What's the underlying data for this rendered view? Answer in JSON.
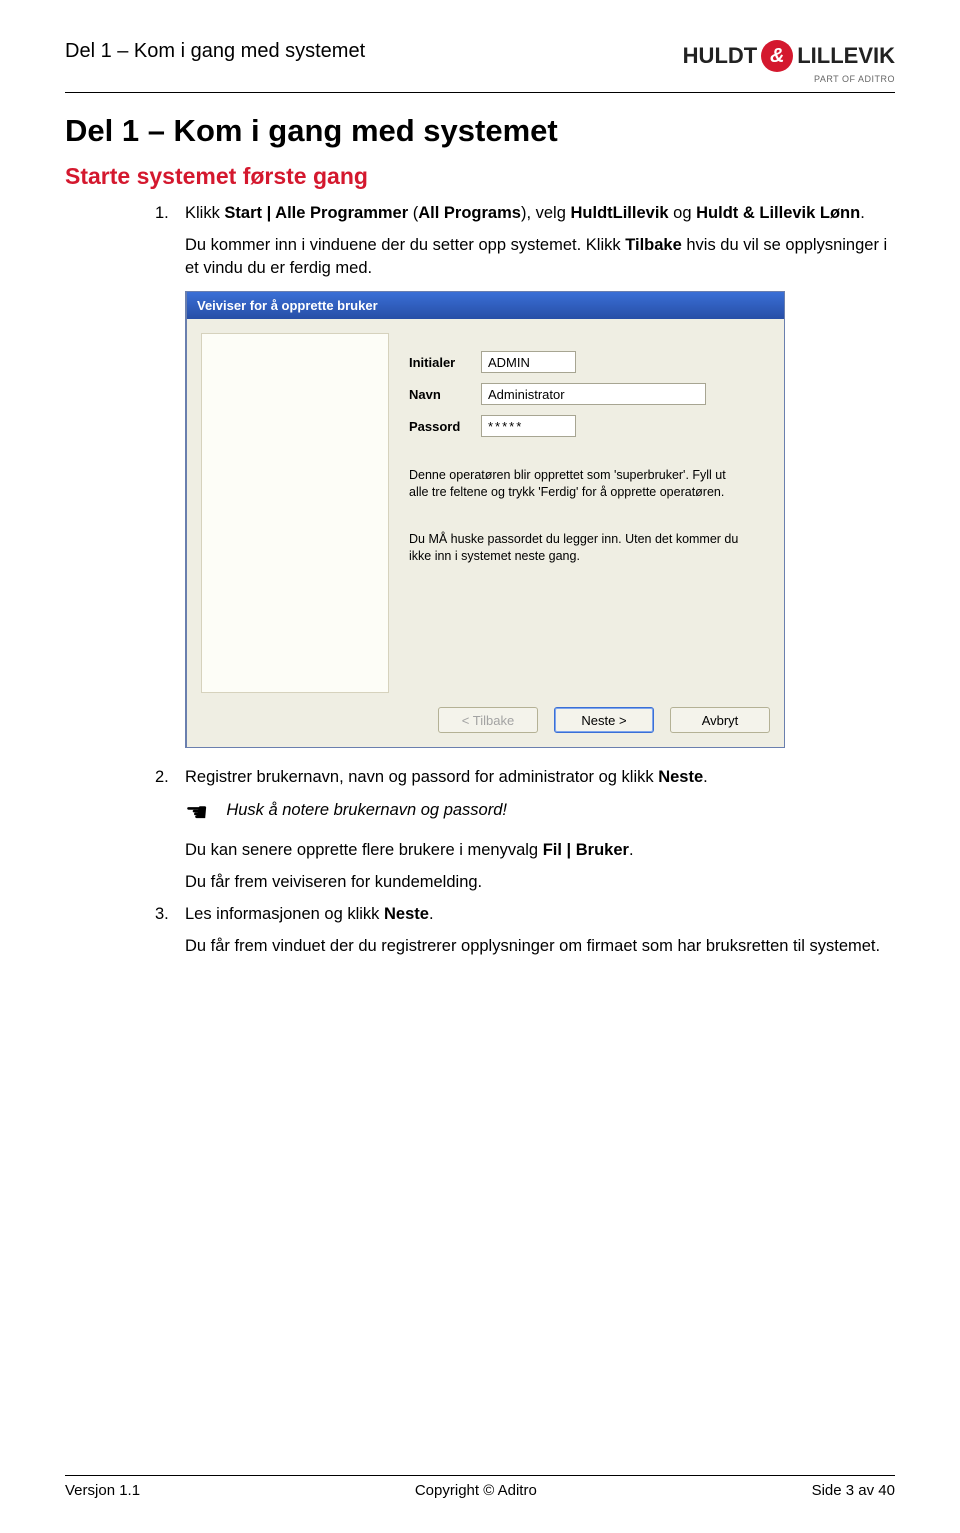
{
  "header": {
    "running_head": "Del 1 – Kom i gang med systemet",
    "logo_left": "HULDT",
    "logo_amp": "&",
    "logo_right": "LILLEVIK",
    "logo_sub": "PART OF ADITRO"
  },
  "title_h1": "Del 1 – Kom i gang med systemet",
  "title_h2": "Starte systemet første gang",
  "steps": {
    "s1": {
      "num": "1.",
      "pre": "Klikk ",
      "b1": "Start | Alle Programmer",
      "mid1": " (",
      "b2": "All Programs",
      "mid2": "), velg ",
      "b3": "HuldtLillevik",
      "mid3": " og ",
      "b4": "Huldt & Lillevik Lønn",
      "post": "."
    },
    "s1b": {
      "pre": "Du kommer inn i vinduene der du setter opp systemet. Klikk ",
      "b1": "Tilbake",
      "post": " hvis du vil se opplysninger i et vindu du er ferdig med."
    },
    "s2": {
      "num": "2.",
      "pre": "Registrer brukernavn, navn og passord for administrator og klikk ",
      "b1": "Neste",
      "post": "."
    },
    "note": "Husk å notere brukernavn og passord!",
    "s2b": {
      "pre": "Du kan senere opprette flere brukere i menyvalg ",
      "b1": "Fil | Bruker",
      "post": "."
    },
    "s2c": "Du får frem veiviseren for kundemelding.",
    "s3": {
      "num": "3.",
      "pre": "Les informasjonen og klikk ",
      "b1": "Neste",
      "post": "."
    },
    "s3b": "Du får frem vinduet der du registrerer opplysninger om firmaet som har bruksretten til systemet."
  },
  "dialog": {
    "title": "Veiviser for å opprette bruker",
    "labels": {
      "initialer": "Initialer",
      "navn": "Navn",
      "passord": "Passord"
    },
    "values": {
      "initialer": "ADMIN",
      "navn": "Administrator",
      "passord": "*****"
    },
    "help1": "Denne operatøren blir opprettet som 'superbruker'. Fyll ut alle tre feltene og trykk 'Ferdig' for å opprette operatøren.",
    "help2": "Du MÅ huske passordet du legger inn. Uten det kommer du ikke inn i systemet neste gang.",
    "buttons": {
      "back": "< Tilbake",
      "next": "Neste >",
      "cancel": "Avbryt"
    }
  },
  "footer": {
    "left": "Versjon 1.1",
    "center": "Copyright © Aditro",
    "right": "Side 3 av 40"
  }
}
